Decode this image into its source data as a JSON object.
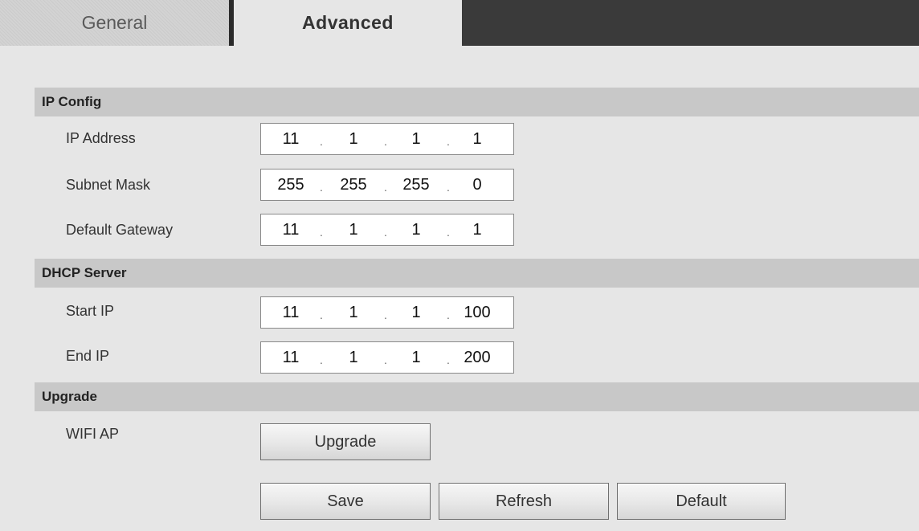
{
  "tabs": [
    {
      "label": "General",
      "active": false
    },
    {
      "label": "Advanced",
      "active": true
    }
  ],
  "ip_config": {
    "title": "IP Config",
    "rows": [
      {
        "label": "IP Address",
        "octets": [
          "11",
          "1",
          "1",
          "1"
        ]
      },
      {
        "label": "Subnet Mask",
        "octets": [
          "255",
          "255",
          "255",
          "0"
        ]
      },
      {
        "label": "Default Gateway",
        "octets": [
          "11",
          "1",
          "1",
          "1"
        ]
      }
    ]
  },
  "dhcp_server": {
    "title": "DHCP Server",
    "rows": [
      {
        "label": "Start IP",
        "octets": [
          "11",
          "1",
          "1",
          "100"
        ]
      },
      {
        "label": "End IP",
        "octets": [
          "11",
          "1",
          "1",
          "200"
        ]
      }
    ]
  },
  "upgrade": {
    "title": "Upgrade",
    "row_label": "WIFI AP",
    "button_label": "Upgrade"
  },
  "actions": {
    "save_label": "Save",
    "refresh_label": "Refresh",
    "default_label": "Default"
  },
  "colors": {
    "tab_bar_bg": "#3a3a3a",
    "section_header_bg": "#c8c8c8",
    "page_bg": "#e6e6e6"
  }
}
